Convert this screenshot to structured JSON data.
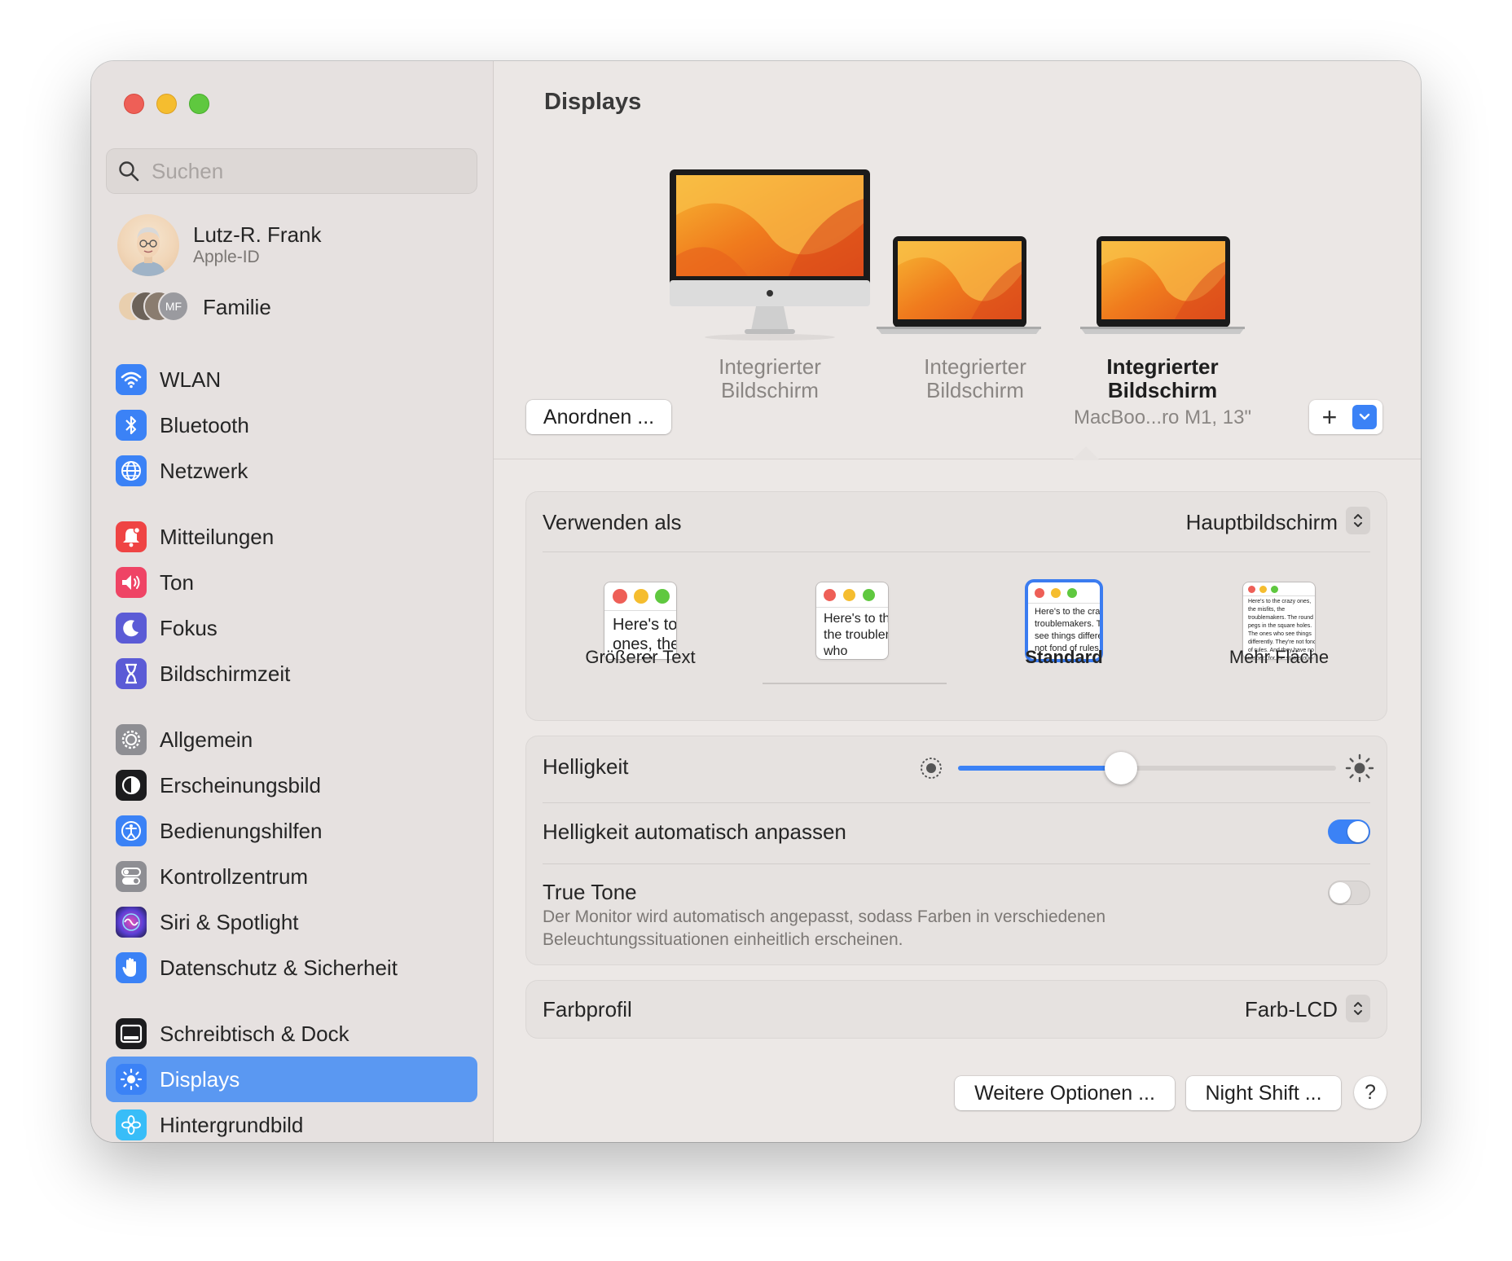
{
  "window": {
    "traffic_lights": [
      "close",
      "minimize",
      "zoom"
    ]
  },
  "sidebar": {
    "search": {
      "placeholder": "Suchen",
      "value": ""
    },
    "account": {
      "name": "Lutz-R. Frank",
      "subtitle": "Apple-ID"
    },
    "family": {
      "label": "Familie",
      "initials": "MF"
    },
    "items": [
      {
        "label": "WLAN",
        "icon": "wifi-icon",
        "color": "#3b82f6"
      },
      {
        "label": "Bluetooth",
        "icon": "bluetooth-icon",
        "color": "#3b82f6"
      },
      {
        "label": "Netzwerk",
        "icon": "globe-icon",
        "color": "#3b82f6"
      },
      {
        "label": "Mitteilungen",
        "icon": "bell-icon",
        "color": "#ef4444"
      },
      {
        "label": "Ton",
        "icon": "speaker-icon",
        "color": "#ef4465"
      },
      {
        "label": "Fokus",
        "icon": "moon-icon",
        "color": "#5b5bd6"
      },
      {
        "label": "Bildschirmzeit",
        "icon": "hourglass-icon",
        "color": "#5b5bd6"
      },
      {
        "label": "Allgemein",
        "icon": "gear-icon",
        "color": "#8e8e93"
      },
      {
        "label": "Erscheinungsbild",
        "icon": "appearance-icon",
        "color": "#1c1c1e"
      },
      {
        "label": "Bedienungshilfen",
        "icon": "accessibility-icon",
        "color": "#3b82f6"
      },
      {
        "label": "Kontrollzentrum",
        "icon": "toggles-icon",
        "color": "#8e8e93"
      },
      {
        "label": "Siri & Spotlight",
        "icon": "siri-icon",
        "color": "#6b21a8"
      },
      {
        "label": "Datenschutz & Sicherheit",
        "icon": "hand-icon",
        "color": "#3b82f6"
      },
      {
        "label": "Schreibtisch & Dock",
        "icon": "dock-icon",
        "color": "#1c1c1e"
      },
      {
        "label": "Displays",
        "icon": "sun-icon",
        "color": "#3b82f6",
        "active": true
      },
      {
        "label": "Hintergrundbild",
        "icon": "flower-icon",
        "color": "#38bdf8"
      }
    ]
  },
  "main": {
    "title": "Displays",
    "displays": [
      {
        "line1": "Integrierter",
        "line2": "Bildschirm",
        "device": "imac"
      },
      {
        "line1": "Integrierter",
        "line2": "Bildschirm",
        "device": "macbook"
      },
      {
        "line1": "Integrierter",
        "line2": "Bildschirm",
        "device": "macbook",
        "selected": true,
        "model": "MacBoo...ro M1, 13\""
      }
    ],
    "arrange_button": "Anordnen ...",
    "add_button": "+",
    "use_as": {
      "label": "Verwenden als",
      "value": "Hauptbildschirm"
    },
    "resolutions": [
      {
        "label": "Größerer Text",
        "sample": "Here's to the crazy ones, the troublemakers"
      },
      {
        "label": "",
        "sample": "Here's to the crazy ones, the troublemakers, the ones who"
      },
      {
        "label": "Standard",
        "selected": true,
        "sample": "Here's to the crazy ones, the troublemakers. The ones who see things differently. They're not fond of rules. And they"
      },
      {
        "label": "Mehr Fläche",
        "sample": "Here's to the crazy ones, the misfits, the troublemakers. The round pegs in the square holes. The ones who see things differently. They're not fond of rules. And they have no respect for the status quo. You can quote them, disagree with them, glorify or vilify them. About the only thing you can't do is ignore them. Because they change things."
      }
    ],
    "brightness": {
      "label": "Helligkeit",
      "value": 0.43
    },
    "auto_brightness": {
      "label": "Helligkeit automatisch anpassen",
      "on": true
    },
    "true_tone": {
      "label": "True Tone",
      "description_line1": "Der Monitor wird automatisch angepasst, sodass Farben in verschiedenen",
      "description_line2": "Beleuchtungssituationen einheitlich erscheinen.",
      "on": false
    },
    "color_profile": {
      "label": "Farbprofil",
      "value": "Farb-LCD"
    },
    "buttons": {
      "more_options": "Weitere Optionen ...",
      "night_shift": "Night Shift ...",
      "help": "?"
    },
    "accent_color": "#3b82f6"
  }
}
